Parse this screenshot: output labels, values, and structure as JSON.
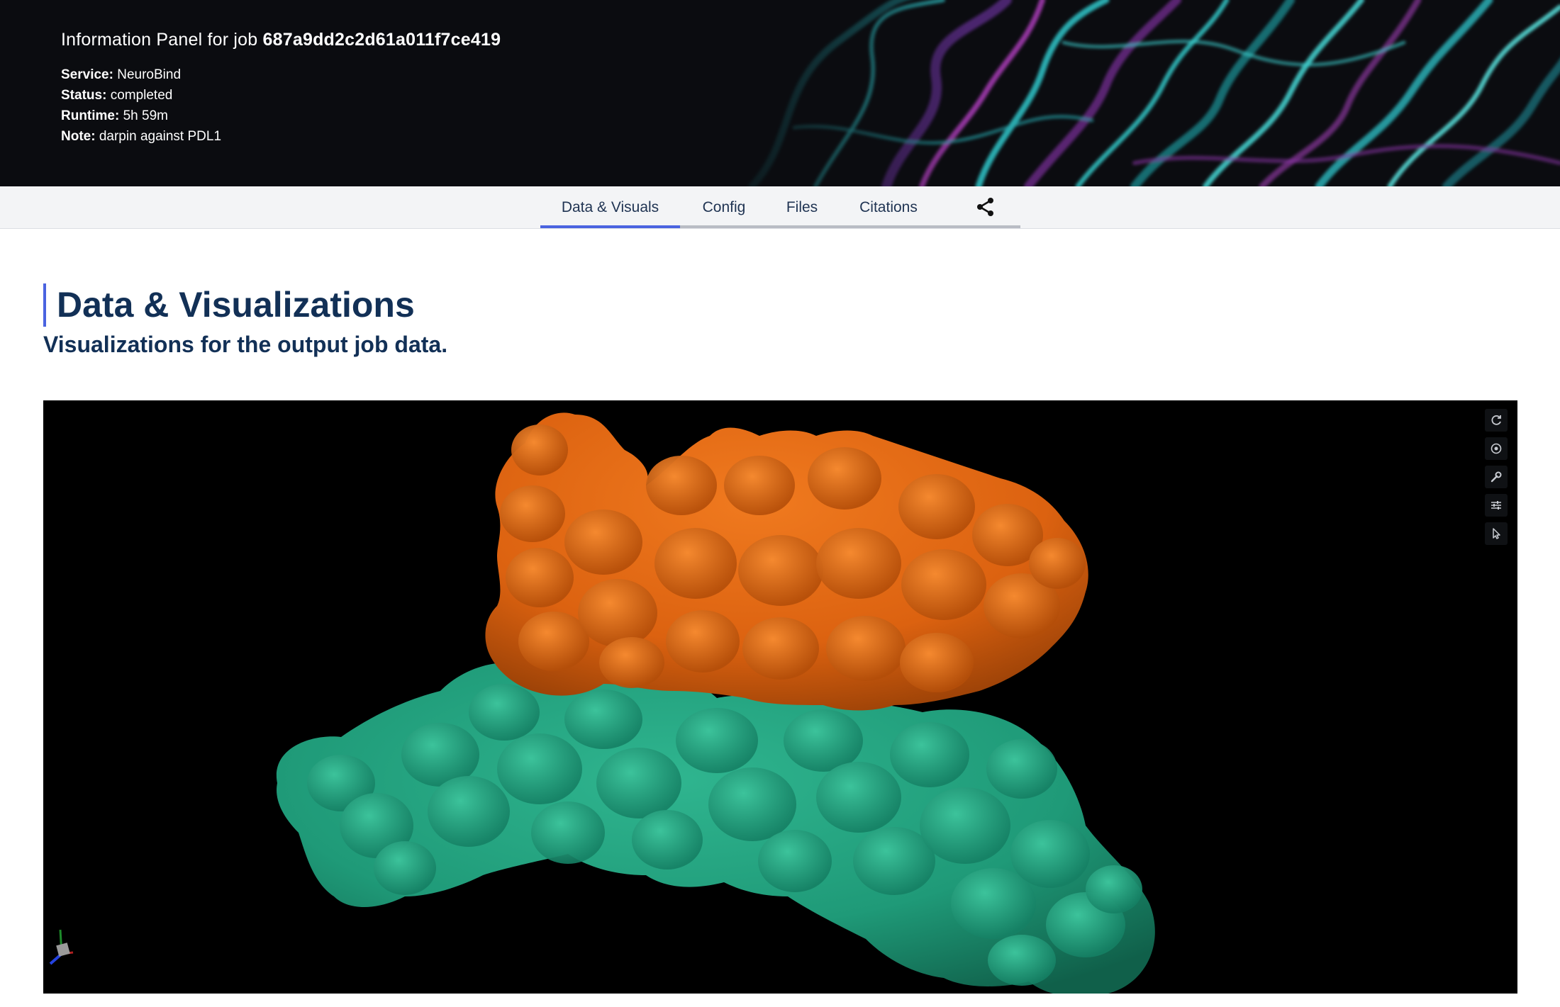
{
  "header": {
    "title_prefix": "Information Panel for job",
    "job_id": "687a9dd2c2d61a011f7ce419",
    "meta": [
      {
        "label": "Service:",
        "value": "NeuroBind"
      },
      {
        "label": "Status:",
        "value": "completed"
      },
      {
        "label": "Runtime:",
        "value": "5h 59m"
      },
      {
        "label": "Note:",
        "value": "darpin against PDL1"
      }
    ]
  },
  "tabs": [
    {
      "label": "Data & Visuals",
      "active": true
    },
    {
      "label": "Config",
      "active": false
    },
    {
      "label": "Files",
      "active": false
    },
    {
      "label": "Citations",
      "active": false
    }
  ],
  "share_icon": "share-icon",
  "section": {
    "title": "Data & Visualizations",
    "subtitle": "Visualizations for the output job data."
  },
  "viewer": {
    "controls": [
      "reset-view-icon",
      "screenshot-icon",
      "wrench-icon",
      "sliders-icon",
      "cursor-icon"
    ],
    "colors": {
      "chain_a": "#e2650e",
      "chain_b": "#1f9a78",
      "background": "#000000",
      "accent": "#4a63e0"
    }
  }
}
